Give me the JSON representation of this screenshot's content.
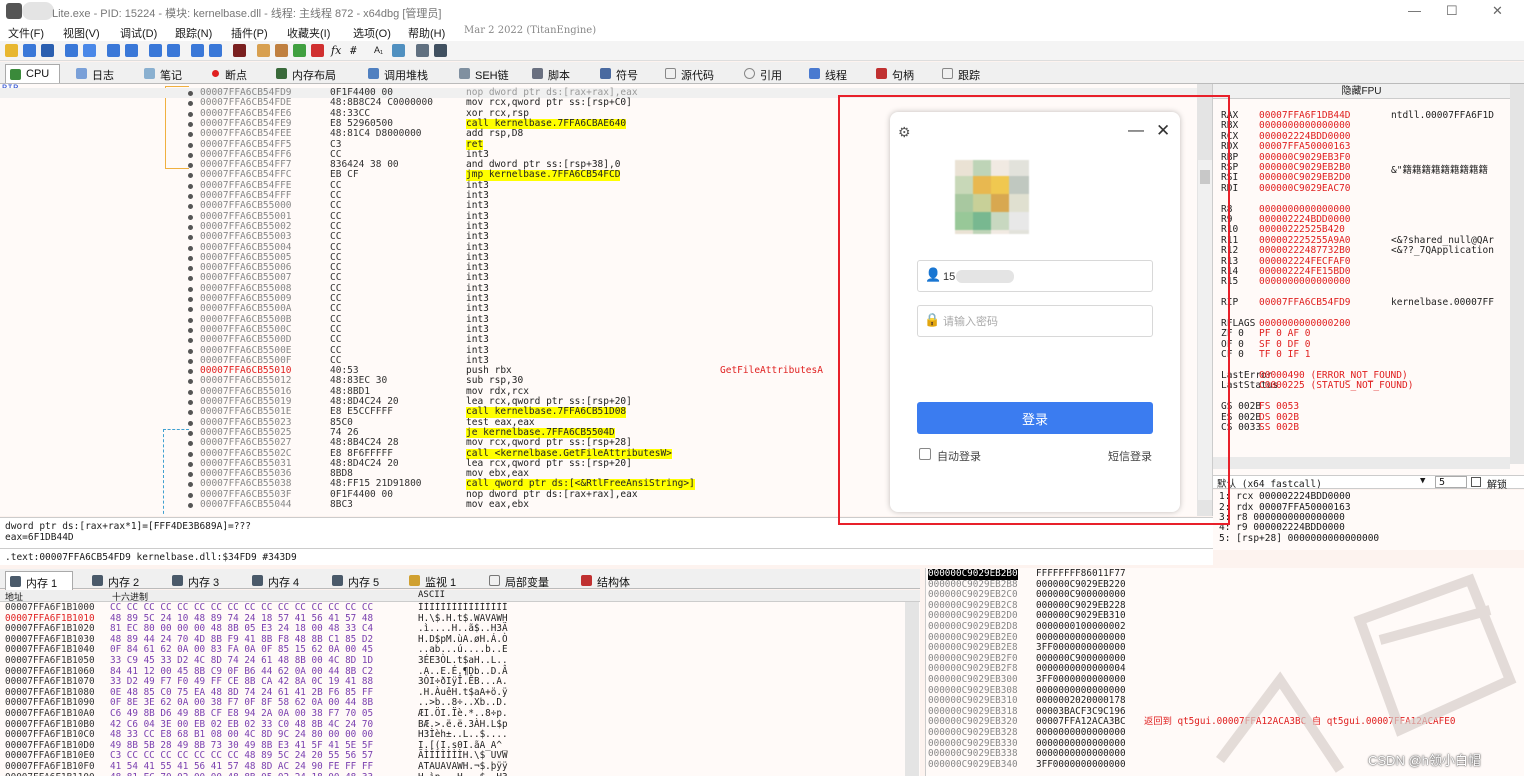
{
  "window": {
    "title": "Lite.exe - PID: 15224 - 模块: kernelbase.dll - 线程: 主线程 872 - x64dbg [管理员]"
  },
  "menu": [
    "文件(F)",
    "视图(V)",
    "调试(D)",
    "跟踪(N)",
    "插件(P)",
    "收藏夹(I)",
    "选项(O)",
    "帮助(H)"
  ],
  "build_date": "Mar 2 2022 (TitanEngine)",
  "tabs": [
    "CPU",
    "日志",
    "笔记",
    "断点",
    "内存布局",
    "调用堆栈",
    "SEH链",
    "脚本",
    "符号",
    "源代码",
    "引用",
    "线程",
    "句柄",
    "跟踪"
  ],
  "disasm": {
    "rip_label": "RIP",
    "rows": [
      {
        "addr": "00007FFA6CB54FD9",
        "bytes": "0F1F4400 00",
        "ins": "nop dword ptr ds:[rax+rax],eax",
        "hl": false
      },
      {
        "addr": "00007FFA6CB54FDE",
        "bytes": "48:8B8C24 C0000000",
        "ins": "mov rcx,qword ptr ss:[rsp+C0]",
        "hl": false
      },
      {
        "addr": "00007FFA6CB54FE6",
        "bytes": "48:33CC",
        "ins": "xor rcx,rsp",
        "hl": false
      },
      {
        "addr": "00007FFA6CB54FE9",
        "bytes": "E8 52960500",
        "ins": "call kernelbase.7FFA6CBAE640",
        "hl": true
      },
      {
        "addr": "00007FFA6CB54FEE",
        "bytes": "48:81C4 D8000000",
        "ins": "add rsp,D8",
        "hl": false
      },
      {
        "addr": "00007FFA6CB54FF5",
        "bytes": "C3",
        "ins": "ret",
        "hl": true
      },
      {
        "addr": "00007FFA6CB54FF6",
        "bytes": "CC",
        "ins": "int3",
        "hl": false
      },
      {
        "addr": "00007FFA6CB54FF7",
        "bytes": "836424 38 00",
        "ins": "and dword ptr ss:[rsp+38],0",
        "hl": false
      },
      {
        "addr": "00007FFA6CB54FFC",
        "bytes": "EB CF",
        "ins": "jmp kernelbase.7FFA6CB54FCD",
        "hl": true
      },
      {
        "addr": "00007FFA6CB54FFE",
        "bytes": "CC",
        "ins": "int3",
        "hl": false
      },
      {
        "addr": "00007FFA6CB54FFF",
        "bytes": "CC",
        "ins": "int3",
        "hl": false
      },
      {
        "addr": "00007FFA6CB55000",
        "bytes": "CC",
        "ins": "int3",
        "hl": false
      },
      {
        "addr": "00007FFA6CB55001",
        "bytes": "CC",
        "ins": "int3",
        "hl": false
      },
      {
        "addr": "00007FFA6CB55002",
        "bytes": "CC",
        "ins": "int3",
        "hl": false
      },
      {
        "addr": "00007FFA6CB55003",
        "bytes": "CC",
        "ins": "int3",
        "hl": false
      },
      {
        "addr": "00007FFA6CB55004",
        "bytes": "CC",
        "ins": "int3",
        "hl": false
      },
      {
        "addr": "00007FFA6CB55005",
        "bytes": "CC",
        "ins": "int3",
        "hl": false
      },
      {
        "addr": "00007FFA6CB55006",
        "bytes": "CC",
        "ins": "int3",
        "hl": false
      },
      {
        "addr": "00007FFA6CB55007",
        "bytes": "CC",
        "ins": "int3",
        "hl": false
      },
      {
        "addr": "00007FFA6CB55008",
        "bytes": "CC",
        "ins": "int3",
        "hl": false
      },
      {
        "addr": "00007FFA6CB55009",
        "bytes": "CC",
        "ins": "int3",
        "hl": false
      },
      {
        "addr": "00007FFA6CB5500A",
        "bytes": "CC",
        "ins": "int3",
        "hl": false
      },
      {
        "addr": "00007FFA6CB5500B",
        "bytes": "CC",
        "ins": "int3",
        "hl": false
      },
      {
        "addr": "00007FFA6CB5500C",
        "bytes": "CC",
        "ins": "int3",
        "hl": false
      },
      {
        "addr": "00007FFA6CB5500D",
        "bytes": "CC",
        "ins": "int3",
        "hl": false
      },
      {
        "addr": "00007FFA6CB5500E",
        "bytes": "CC",
        "ins": "int3",
        "hl": false
      },
      {
        "addr": "00007FFA6CB5500F",
        "bytes": "CC",
        "ins": "int3",
        "hl": false
      },
      {
        "addr": "00007FFA6CB55010",
        "bytes": "40:53",
        "ins": "push rbx",
        "hl": false,
        "red": true,
        "cmt": "GetFileAttributesA"
      },
      {
        "addr": "00007FFA6CB55012",
        "bytes": "48:83EC 30",
        "ins": "sub rsp,30",
        "hl": false
      },
      {
        "addr": "00007FFA6CB55016",
        "bytes": "48:8BD1",
        "ins": "mov rdx,rcx",
        "hl": false
      },
      {
        "addr": "00007FFA6CB55019",
        "bytes": "48:8D4C24 20",
        "ins": "lea rcx,qword ptr ss:[rsp+20]",
        "hl": false
      },
      {
        "addr": "00007FFA6CB5501E",
        "bytes": "E8 E5CCFFFF",
        "ins": "call kernelbase.7FFA6CB51D08",
        "hl": true
      },
      {
        "addr": "00007FFA6CB55023",
        "bytes": "85C0",
        "ins": "test eax,eax",
        "hl": false
      },
      {
        "addr": "00007FFA6CB55025",
        "bytes": "74 26",
        "ins": "je kernelbase.7FFA6CB5504D",
        "hl": true
      },
      {
        "addr": "00007FFA6CB55027",
        "bytes": "48:8B4C24 28",
        "ins": "mov rcx,qword ptr ss:[rsp+28]",
        "hl": false
      },
      {
        "addr": "00007FFA6CB5502C",
        "bytes": "E8 8F6FFFFF",
        "ins": "call <kernelbase.GetFileAttributesW>",
        "hl": true
      },
      {
        "addr": "00007FFA6CB55031",
        "bytes": "48:8D4C24 20",
        "ins": "lea rcx,qword ptr ss:[rsp+20]",
        "hl": false
      },
      {
        "addr": "00007FFA6CB55036",
        "bytes": "8BD8",
        "ins": "mov ebx,eax",
        "hl": false
      },
      {
        "addr": "00007FFA6CB55038",
        "bytes": "48:FF15 21D91800",
        "ins": "call qword ptr ds:[<&RtlFreeAnsiString>]",
        "hl": true
      },
      {
        "addr": "00007FFA6CB5503F",
        "bytes": "0F1F4400 00",
        "ins": "nop dword ptr ds:[rax+rax],eax",
        "hl": false
      },
      {
        "addr": "00007FFA6CB55044",
        "bytes": "8BC3",
        "ins": "mov eax,ebx",
        "hl": false
      }
    ]
  },
  "info": {
    "line1": "dword ptr ds:[rax+rax*1]=[FFF4DE3B689A]=???",
    "line2": "eax=6F1DB44D",
    "line3": ".text:00007FFA6CB54FD9 kernelbase.dll:$34FD9 #343D9"
  },
  "registers": {
    "header": "隐藏FPU",
    "rows": [
      {
        "n": "RAX",
        "v": "00007FFA6F1DB44D",
        "c": "ntdll.00007FFA6F1D"
      },
      {
        "n": "RBX",
        "v": "0000000000000000",
        "c": ""
      },
      {
        "n": "RCX",
        "v": "000002224BDD0000",
        "c": ""
      },
      {
        "n": "RDX",
        "v": "00007FFA50000163",
        "c": ""
      },
      {
        "n": "RBP",
        "v": "000000C9029EB3F0",
        "c": ""
      },
      {
        "n": "RSP",
        "v": "000000C9029EB2B0",
        "c": "&\"籍籍籍籍籍籍籍籍籍"
      },
      {
        "n": "RSI",
        "v": "000000C9029EB2D0",
        "c": ""
      },
      {
        "n": "RDI",
        "v": "000000C9029EAC70",
        "c": ""
      },
      {
        "n": "",
        "v": "",
        "c": ""
      },
      {
        "n": "R8",
        "v": "0000000000000000",
        "c": ""
      },
      {
        "n": "R9",
        "v": "000002224BDD0000",
        "c": ""
      },
      {
        "n": "R10",
        "v": "00000222525B420",
        "c": ""
      },
      {
        "n": "R11",
        "v": "000002225255A9A0",
        "c": "<&?shared_null@QAr"
      },
      {
        "n": "R12",
        "v": "00000222487732B0",
        "c": "<&??_7QApplication"
      },
      {
        "n": "R13",
        "v": "000002224FECFAF0",
        "c": ""
      },
      {
        "n": "R14",
        "v": "000002224FE15BD0",
        "c": ""
      },
      {
        "n": "R15",
        "v": "0000000000000000",
        "c": ""
      },
      {
        "n": "",
        "v": "",
        "c": ""
      },
      {
        "n": "RIP",
        "v": "00007FFA6CB54FD9",
        "c": "kernelbase.00007FF"
      },
      {
        "n": "",
        "v": "",
        "c": ""
      },
      {
        "n": "RFLAGS",
        "v": "0000000000000200",
        "c": ""
      },
      {
        "n": "ZF 0",
        "v": "PF 0   AF 0",
        "c": ""
      },
      {
        "n": "OF 0",
        "v": "SF 0   DF 0",
        "c": ""
      },
      {
        "n": "CF 0",
        "v": "TF 0   IF 1",
        "c": ""
      },
      {
        "n": "",
        "v": "",
        "c": ""
      },
      {
        "n": "LastError",
        "v": "00000490 (ERROR_NOT_FOUND)",
        "c": ""
      },
      {
        "n": "LastStatus",
        "v": "C0000225 (STATUS_NOT_FOUND)",
        "c": ""
      },
      {
        "n": "",
        "v": "",
        "c": ""
      },
      {
        "n": "GS 002B",
        "v": "FS 0053",
        "c": ""
      },
      {
        "n": "ES 002B",
        "v": "DS 002B",
        "c": ""
      },
      {
        "n": "CS 0033",
        "v": "SS 002B",
        "c": ""
      }
    ]
  },
  "callconv": {
    "label": "默认 (x64 fastcall)",
    "count": "5",
    "unlock": "解锁"
  },
  "stack_args": [
    "1: rcx 000002224BDD0000",
    "2: rdx 00007FFA50000163",
    "3: r8 0000000000000000",
    "4: r9 000002224BDD0000",
    "5: [rsp+28] 0000000000000000"
  ],
  "dump_tabs": [
    "内存 1",
    "内存 2",
    "内存 3",
    "内存 4",
    "内存 5",
    "监视 1",
    "局部变量",
    "结构体"
  ],
  "dump_header": {
    "addr": "地址",
    "hex": "十六进制",
    "ascii": "ASCII"
  },
  "dump_rows": [
    {
      "a": "00007FFA6F1B1000",
      "h": "CC CC CC CC CC CC CC CC CC CC CC CC CC CC CC CC",
      "s": "ÌÌÌÌÌÌÌÌÌÌÌÌÌÌÌÌ"
    },
    {
      "a": "00007FFA6F1B1010",
      "h": "48 89 5C 24 10 48 89 74 24 18 57 41 56 41 57 48",
      "s": "H.\\$.H.t$.WAVAWH",
      "red": true
    },
    {
      "a": "00007FFA6F1B1020",
      "h": "81 EC 80 00 00 00 48 8B 05 E3 24 18 00 48 33 C4",
      "s": ".ì....H..ã$..H3Ä"
    },
    {
      "a": "00007FFA6F1B1030",
      "h": "48 89 44 24 70 4D 8B F9 41 8B F8 48 8B C1 85 D2",
      "s": "H.D$pM.ùA.øH.Á.Ò"
    },
    {
      "a": "00007FFA6F1B1040",
      "h": "0F 84 61 62 0A 00 83 FA 0A 0F 85 15 62 0A 00 45",
      "s": "..ab...ú....b..E"
    },
    {
      "a": "00007FFA6F1B1050",
      "h": "33 C9 45 33 D2 4C 8D 74 24 61 48 8B 00 4C 8D 1D",
      "s": "3ÉE3ÒL.t$aH..L.."
    },
    {
      "a": "00007FFA6F1B1060",
      "h": "84 41 12 00 45 8B C9 0F B6 44 62 0A 00 44 8B C2",
      "s": ".A..E.É.¶Db..D.Â"
    },
    {
      "a": "00007FFA6F1B1070",
      "h": "33 D2 49 F7 F0 49 FF CE 8B CA 42 8A 0C 19 41 88",
      "s": "3ÒI÷ðIÿÎ.ÊB...A."
    },
    {
      "a": "00007FFA6F1B1080",
      "h": "0E 48 85 C0 75 EA 48 8D 74 24 61 41 2B F6 85 FF",
      "s": ".H.ÀuêH.t$aA+ö.ÿ"
    },
    {
      "a": "00007FFA6F1B1090",
      "h": "0F 8E 3E 62 0A 00 38 F7 0F 8F 58 62 0A 00 44 8B",
      "s": "..>b..8÷..Xb..D."
    },
    {
      "a": "00007FFA6F1B10A0",
      "h": "C6 49 8B D6 49 8B CF E8 94 2A 0A 00 38 F7 70 05",
      "s": "ÆI.ÖI.Ïè.*..8÷p."
    },
    {
      "a": "00007FFA6F1B10B0",
      "h": "42 C6 04 3E 00 EB 02 EB 02 33 C0 48 8B 4C 24 70",
      "s": "BÆ.>.ë.ë.3ÀH.L$p"
    },
    {
      "a": "00007FFA6F1B10C0",
      "h": "48 33 CC E8 68 B1 08 00 4C 8D 9C 24 80 00 00 00",
      "s": "H3Ìèh±..L..$...."
    },
    {
      "a": "00007FFA6F1B10D0",
      "h": "49 8B 5B 28 49 8B 73 30 49 8B E3 41 5F 41 5E 5F",
      "s": "I.[(I.s0I.ãA_A^_"
    },
    {
      "a": "00007FFA6F1B10E0",
      "h": "C3 CC CC CC CC CC CC CC 48 89 5C 24 20 55 56 57",
      "s": "ÃÌÌÌÌÌÌÌH.\\$ UVW"
    },
    {
      "a": "00007FFA6F1B10F0",
      "h": "41 54 41 55 41 56 41 57 48 8D AC 24 90 FE FF FF",
      "s": "ATAUAVAWH.¬$.þÿÿ"
    },
    {
      "a": "00007FFA6F1B1100",
      "h": "48 81 EC 70 02 00 00 48 8B 05 02 24 18 00 48 33",
      "s": "H.ìp...H...$..H3"
    }
  ],
  "stack_rows": [
    {
      "a": "000000C9029EB2B0",
      "v": "FFFFFFFF86011F77",
      "sel": true
    },
    {
      "a": "000000C9029EB2B8",
      "v": "000000C9029EB220"
    },
    {
      "a": "000000C9029EB2C0",
      "v": "000000C900000000"
    },
    {
      "a": "000000C9029EB2C8",
      "v": "000000C9029EB228"
    },
    {
      "a": "000000C9029EB2D0",
      "v": "000000C9029EB310"
    },
    {
      "a": "000000C9029EB2D8",
      "v": "0000000100000002"
    },
    {
      "a": "000000C9029EB2E0",
      "v": "0000000000000000"
    },
    {
      "a": "000000C9029EB2E8",
      "v": "3FF0000000000000"
    },
    {
      "a": "000000C9029EB2F0",
      "v": "000000C900000000"
    },
    {
      "a": "000000C9029EB2F8",
      "v": "0000000000000004"
    },
    {
      "a": "000000C9029EB300",
      "v": "3FF0000000000000"
    },
    {
      "a": "000000C9029EB308",
      "v": "0000000000000000"
    },
    {
      "a": "000000C9029EB310",
      "v": "0000002020000178"
    },
    {
      "a": "000000C9029EB318",
      "v": "00003BACF3C9C196"
    },
    {
      "a": "000000C9029EB320",
      "v": "00007FFA12ACA3BC",
      "cmt": "返回到 qt5gui.00007FFA12ACA3BC 自 qt5gui.00007FFA12ACAFE0"
    },
    {
      "a": "000000C9029EB328",
      "v": "0000000000000000"
    },
    {
      "a": "000000C9029EB330",
      "v": "0000000000000000"
    },
    {
      "a": "000000C9029EB338",
      "v": "0000000000000000"
    },
    {
      "a": "000000C9029EB340",
      "v": "3FF0000000000000"
    }
  ],
  "login": {
    "username_value": "15",
    "password_placeholder": "请输入密码",
    "login_button": "登录",
    "auto_login": "自动登录",
    "sms_login": "短信登录"
  },
  "watermark": "CSDN @h领小白帽"
}
